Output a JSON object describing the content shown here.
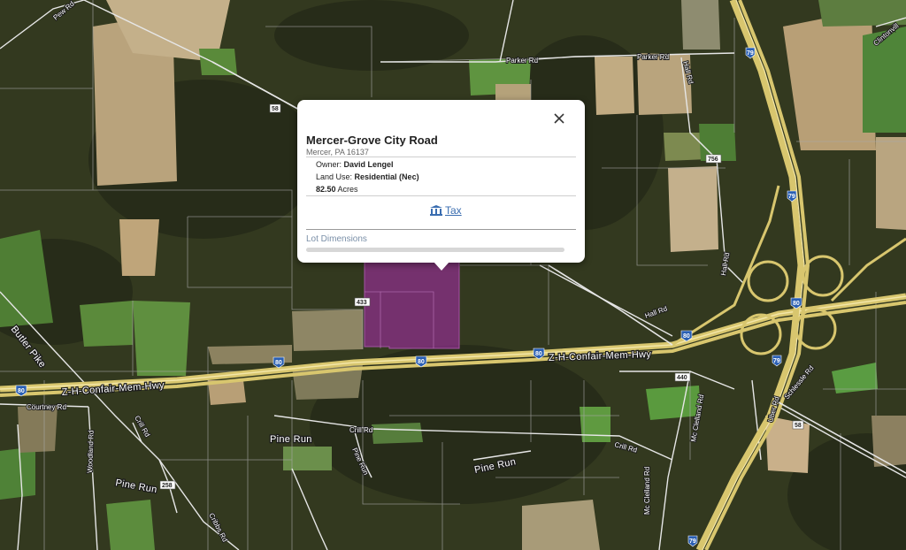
{
  "map": {
    "roads": {
      "pew_rd": "Pew Rd",
      "parker_rd_1": "Parker Rd",
      "parker_rd_2": "Parker Rd",
      "hall_rd_1": "Hall Rd",
      "hall_rd_2": "Hall Rd",
      "hall_rd_3": "Hall Rd",
      "clintonville_rd": "Clintonvill",
      "butler_pike": "Butler Pike",
      "zh_confair_1": "Z-H-Confair-Mem-Hwy",
      "zh_confair_2": "Z-H-Confair-Mem-Hwy",
      "courtney_rd": "Courtney Rd",
      "woodland_rd": "Woodland Rd",
      "crill_rd_1": "Crill Rd",
      "crill_rd_2": "Crill Rd",
      "crill_rd_3": "Crill Rd",
      "pine_run_1": "Pine Run",
      "pine_run_2": "Pine Run",
      "pine_run_3": "Pine Run",
      "pine_run_4": "Pine Run",
      "cribbs_rd": "Cribbs Rd",
      "mc_clelland_rd_1": "Mc Clelland Rd",
      "mc_clelland_rd_2": "Mc Clelland Rd",
      "uber_rd": "Uber Rd",
      "schlessle_rd": "Schlessle Rd"
    },
    "shields": {
      "s58_a": "58",
      "s58_b": "58",
      "s79_a": "79",
      "s79_b": "79",
      "s79_c": "79",
      "s79_d": "79",
      "s80_a": "80",
      "s80_b": "80",
      "s80_c": "80",
      "s80_d": "80",
      "s80_e": "80",
      "s80_f": "80",
      "s756": "756",
      "s440": "440",
      "s258": "258",
      "s433": "433"
    },
    "parcel_color": "#8c2f8a"
  },
  "popup": {
    "title": "Mercer-Grove City Road",
    "subtitle": "Mercer, PA 16137",
    "owner_label": "Owner:",
    "owner_value": "David Lengel",
    "land_use_label": "Land Use:",
    "land_use_value": "Residential (Nec)",
    "acres_value": "82.50",
    "acres_label": "Acres",
    "tax_link": "Tax",
    "lot_dimensions": "Lot Dimensions",
    "close_icon": "close-icon",
    "tax_icon": "bank-icon"
  }
}
